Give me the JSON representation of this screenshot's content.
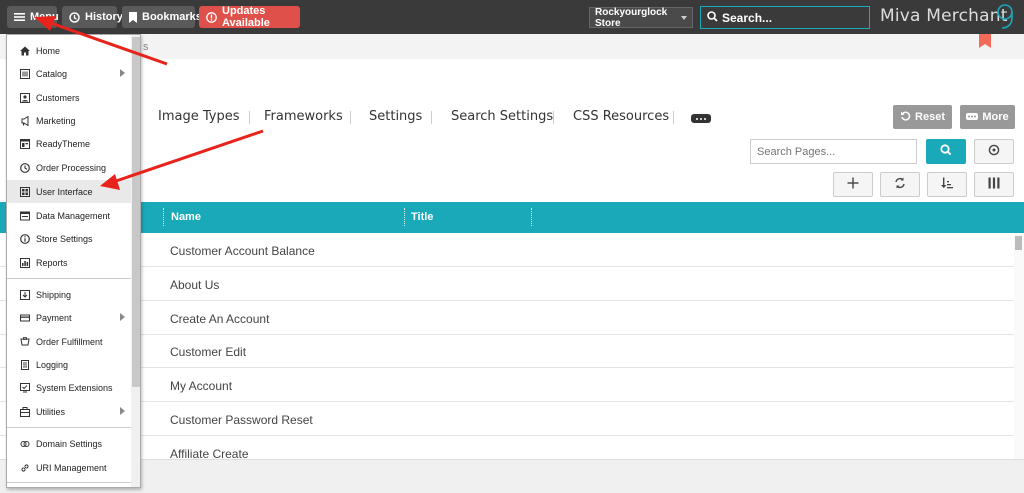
{
  "topbar": {
    "menu_label": "Menu",
    "history_label": "History",
    "bookmarks_label": "Bookmarks",
    "updates_label": "Updates Available",
    "store_select": "Rockyourglock Store",
    "search_label": "Search...",
    "brand": "Miva Merchant"
  },
  "breadcrumb_tail": "s",
  "tabs": [
    "Image Types",
    "Frameworks",
    "Settings",
    "Search Settings",
    "CSS Resources"
  ],
  "actions": {
    "reset_label": "Reset",
    "more_label": "More",
    "search_pages_placeholder": "Search Pages..."
  },
  "grid": {
    "columns": [
      "Name",
      "Title"
    ],
    "rows": [
      "Customer Account Balance",
      "About Us",
      "Create An Account",
      "Customer Edit",
      "My Account",
      "Customer Password Reset",
      "Affiliate Create"
    ]
  },
  "menu": {
    "items": [
      {
        "label": "Home",
        "icon": "home-icon"
      },
      {
        "label": "Catalog",
        "icon": "catalog-icon",
        "submenu": true
      },
      {
        "label": "Customers",
        "icon": "customers-icon"
      },
      {
        "label": "Marketing",
        "icon": "marketing-icon"
      },
      {
        "label": "ReadyTheme",
        "icon": "readytheme-icon"
      },
      {
        "label": "Order Processing",
        "icon": "order-processing-icon"
      },
      {
        "label": "User Interface",
        "icon": "user-interface-icon",
        "active": true
      },
      {
        "label": "Data Management",
        "icon": "data-management-icon"
      },
      {
        "label": "Store Settings",
        "icon": "store-settings-icon"
      },
      {
        "label": "Reports",
        "icon": "reports-icon"
      },
      {
        "label": "Shipping",
        "icon": "shipping-icon"
      },
      {
        "label": "Payment",
        "icon": "payment-icon",
        "submenu": true
      },
      {
        "label": "Order Fulfillment",
        "icon": "order-fulfillment-icon"
      },
      {
        "label": "Logging",
        "icon": "logging-icon"
      },
      {
        "label": "System Extensions",
        "icon": "system-extensions-icon"
      },
      {
        "label": "Utilities",
        "icon": "utilities-icon",
        "submenu": true
      },
      {
        "label": "Domain Settings",
        "icon": "domain-settings-icon"
      },
      {
        "label": "URI Management",
        "icon": "uri-management-icon"
      }
    ]
  },
  "colors": {
    "accent": "#1aa9b8",
    "topbar": "#3a3a3a",
    "updates": "#e0504a",
    "annotation_arrow": "#e8231c"
  }
}
